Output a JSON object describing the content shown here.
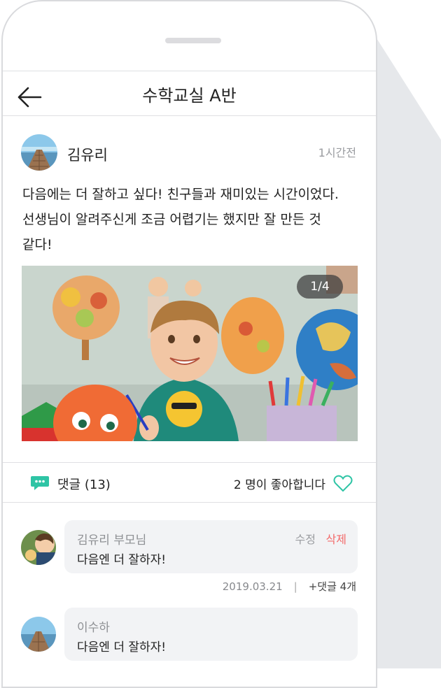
{
  "header": {
    "title": "수학교실 A반"
  },
  "post": {
    "author": "김유리",
    "time": "1시간전",
    "body_lines": [
      "다음에는 더 잘하고 싶다! 친구들과 재미있는 시간이었다.",
      "선생님이 알려주신게 조금 어렵기는 했지만 잘 만든 것",
      "같다!"
    ],
    "photo_pager": "1/4"
  },
  "actions": {
    "comment_label": "댓글 (13)",
    "like_text": "2 명이 좋아합니다"
  },
  "comments": [
    {
      "name": "김유리 부모님",
      "text": "다음엔 더 잘하자!",
      "edit_label": "수정",
      "delete_label": "삭제",
      "date": "2019.03.21",
      "reply_label": "+댓글 4개"
    },
    {
      "name": "이수하",
      "text": "다음엔 더 잘하자!"
    }
  ],
  "colors": {
    "accent_green": "#2ec4a5",
    "delete_red": "#f36a6a"
  },
  "icons": [
    "back-arrow-icon",
    "comment-bubble-icon",
    "heart-outline-icon"
  ]
}
